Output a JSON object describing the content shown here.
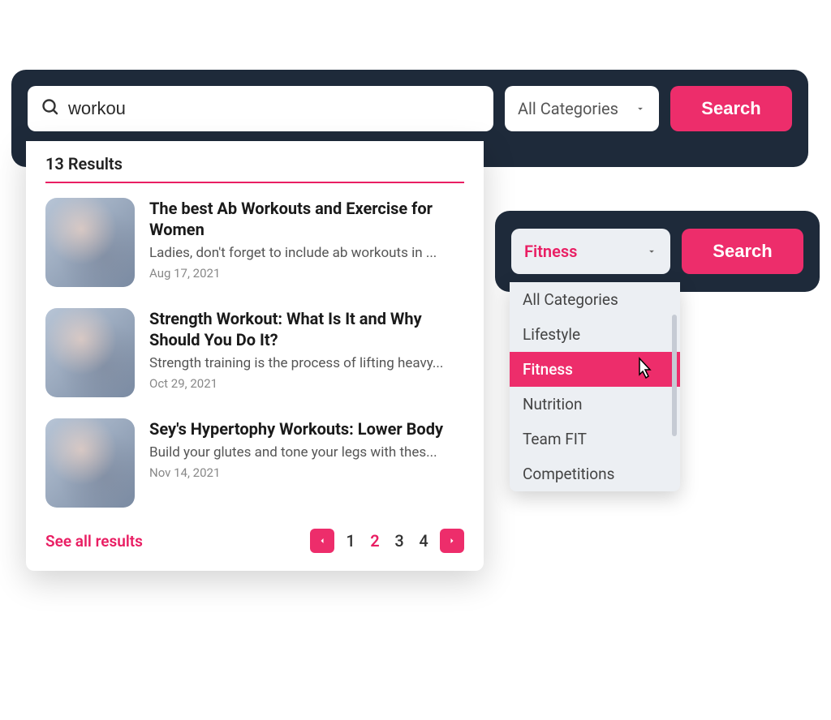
{
  "panelA": {
    "search_value": "workou",
    "category_label": "All Categories",
    "search_button": "Search"
  },
  "panelB": {
    "category_label": "Fitness",
    "search_button": "Search"
  },
  "dropdown": {
    "results_header": "13 Results",
    "see_all": "See all results",
    "items": [
      {
        "title": "The best Ab Workouts and Exercise for Women",
        "desc": "Ladies, don't forget to include ab workouts in ...",
        "date": "Aug 17, 2021"
      },
      {
        "title": "Strength Workout: What Is It and Why Should You Do It?",
        "desc": "Strength training is the process of lifting heavy...",
        "date": "Oct 29, 2021"
      },
      {
        "title": "Sey's Hypertophy Workouts: Lower Body",
        "desc": "Build your glutes and tone your legs with thes...",
        "date": "Nov 14, 2021"
      }
    ],
    "pages": [
      "1",
      "2",
      "3",
      "4"
    ],
    "active_page": "2"
  },
  "options": [
    "All Categories",
    "Lifestyle",
    "Fitness",
    "Nutrition",
    "Team FIT",
    "Competitions"
  ],
  "selected_option": "Fitness"
}
